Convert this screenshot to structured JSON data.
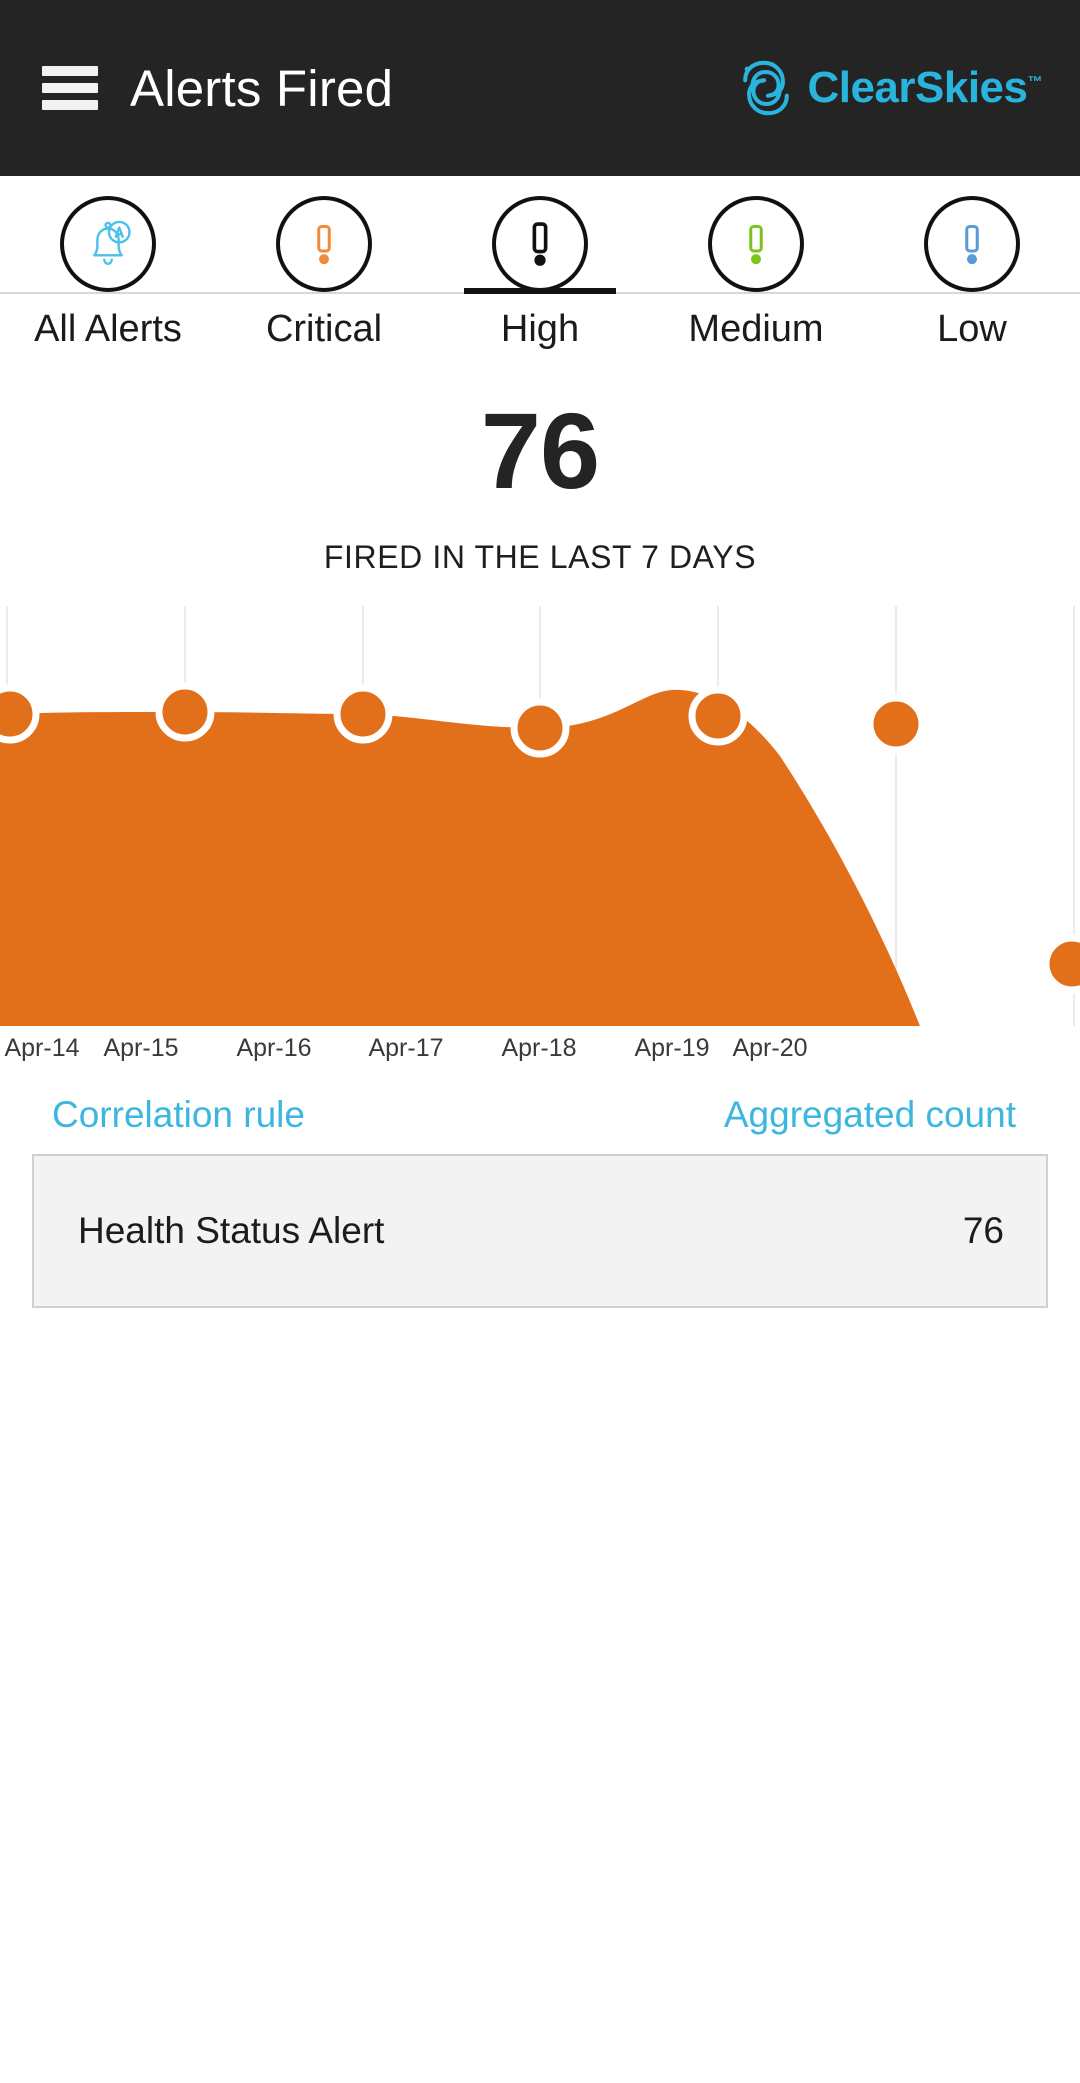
{
  "header": {
    "title": "Alerts Fired",
    "menu_icon": "hamburger-menu-icon",
    "brand_name": "ClearSkies",
    "brand_tm": "™",
    "brand_color": "#29b4dd",
    "background_color": "#242424"
  },
  "tabs": [
    {
      "label": "All Alerts",
      "icon": "bell-auto-icon",
      "icon_color": "#4cc0e8",
      "active": false
    },
    {
      "label": "Critical",
      "icon": "exclamation-mark-icon",
      "icon_color": "#f08b3c",
      "active": false
    },
    {
      "label": "High",
      "icon": "exclamation-mark-icon",
      "icon_color": "#111111",
      "active": true
    },
    {
      "label": "Medium",
      "icon": "exclamation-mark-icon",
      "icon_color": "#7ac41c",
      "active": false
    },
    {
      "label": "Low",
      "icon": "exclamation-mark-icon",
      "icon_color": "#5a9bd8",
      "active": false
    }
  ],
  "summary": {
    "count": "76",
    "caption": "FIRED IN THE LAST 7 DAYS"
  },
  "table": {
    "columns": [
      "Correlation rule",
      "Aggregated count"
    ],
    "rows": [
      {
        "rule": "Health Status Alert",
        "count": "76"
      }
    ]
  },
  "chart_data": {
    "type": "area",
    "title": "",
    "xlabel": "",
    "ylabel": "",
    "series_color": "#e2701a",
    "marker_ring_color": "#ffffff",
    "grid": true,
    "legend": "none",
    "categories": [
      "Apr-14",
      "Apr-15",
      "Apr-16",
      "Apr-17",
      "Apr-18",
      "Apr-19",
      "Apr-20"
    ],
    "values": [
      13,
      13,
      13,
      13,
      12,
      13,
      4
    ],
    "ylim": [
      0,
      14
    ],
    "tick_labels": [
      "Apr-14",
      "Apr-15",
      "Apr-16",
      "Apr-17",
      "Apr-18",
      "Apr-19",
      "Apr-20"
    ]
  }
}
